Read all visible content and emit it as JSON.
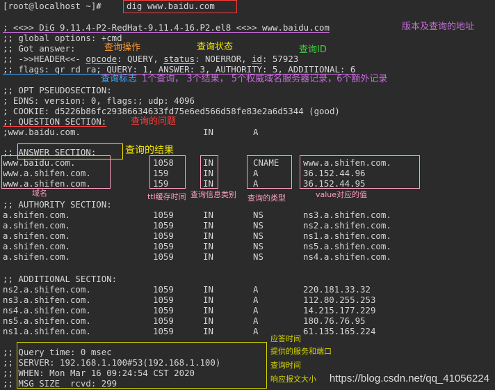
{
  "prompt": "[root@localhost ~]#",
  "command": "dig www.baidu.com",
  "header": {
    "banner": "; <<>> DiG 9.11.4-P2-RedHat-9.11.4-16.P2.el8 <<>> www.baidu.com",
    "global_options": ";; global options: +cmd",
    "got_answer": ";; Got answer:",
    "hdr_prefix": ";; ->>HEADER<<- ",
    "opcode": "opcode",
    "opcode_val": ": QUERY, ",
    "status": "status",
    "status_val": ": NOERROR, ",
    "id": "id",
    "id_val": ": 57923",
    "flags": ";; flags: qr rd ra;",
    "counts": " QUERY: 1, ANSWER: 3, AUTHORITY: 5, ADDITIONAL: 6"
  },
  "opt": {
    "title": ";; OPT PSEUDOSECTION:",
    "edns": "; EDNS: version: 0, flags:; udp: 4096",
    "cookie": "; COOKIE: d5226b86fc29386634633fd75e6ed566d58fe83e2a6d5344 (good)"
  },
  "question": {
    "title": ";; QUESTION SECTION:",
    "row": {
      "name": ";www.baidu.com.",
      "cls": "IN",
      "type": "A"
    }
  },
  "answer": {
    "title": ";; ANSWER SECTION:",
    "rows": [
      {
        "name": "www.baidu.com.",
        "ttl": "1058",
        "cls": "IN",
        "type": "CNAME",
        "value": "www.a.shifen.com."
      },
      {
        "name": "www.a.shifen.com.",
        "ttl": "159",
        "cls": "IN",
        "type": "A",
        "value": "36.152.44.96"
      },
      {
        "name": "www.a.shifen.com.",
        "ttl": "159",
        "cls": "IN",
        "type": "A",
        "value": "36.152.44.95"
      }
    ]
  },
  "authority": {
    "title": ";; AUTHORITY SECTION:",
    "rows": [
      {
        "name": "a.shifen.com.",
        "ttl": "1059",
        "cls": "IN",
        "type": "NS",
        "value": "ns3.a.shifen.com."
      },
      {
        "name": "a.shifen.com.",
        "ttl": "1059",
        "cls": "IN",
        "type": "NS",
        "value": "ns2.a.shifen.com."
      },
      {
        "name": "a.shifen.com.",
        "ttl": "1059",
        "cls": "IN",
        "type": "NS",
        "value": "ns1.a.shifen.com."
      },
      {
        "name": "a.shifen.com.",
        "ttl": "1059",
        "cls": "IN",
        "type": "NS",
        "value": "ns5.a.shifen.com."
      },
      {
        "name": "a.shifen.com.",
        "ttl": "1059",
        "cls": "IN",
        "type": "NS",
        "value": "ns4.a.shifen.com."
      }
    ]
  },
  "additional": {
    "title": ";; ADDITIONAL SECTION:",
    "rows": [
      {
        "name": "ns2.a.shifen.com.",
        "ttl": "1059",
        "cls": "IN",
        "type": "A",
        "value": "220.181.33.32"
      },
      {
        "name": "ns3.a.shifen.com.",
        "ttl": "1059",
        "cls": "IN",
        "type": "A",
        "value": "112.80.255.253"
      },
      {
        "name": "ns4.a.shifen.com.",
        "ttl": "1059",
        "cls": "IN",
        "type": "A",
        "value": "14.215.177.229"
      },
      {
        "name": "ns5.a.shifen.com.",
        "ttl": "1059",
        "cls": "IN",
        "type": "A",
        "value": "180.76.76.95"
      },
      {
        "name": "ns1.a.shifen.com.",
        "ttl": "1059",
        "cls": "IN",
        "type": "A",
        "value": "61.135.165.224"
      }
    ]
  },
  "footer": {
    "query_time": ";; Query time: 0 msec",
    "server": ";; SERVER: 192.168.1.100#53(192.168.1.100)",
    "when": ";; WHEN: Mon Mar 16 09:24:54 CST 2020",
    "msg_size": ";; MSG SIZE  rcvd: 299"
  },
  "annotations": {
    "version": "版本及查询的地址",
    "opcode": "查询操作",
    "status": "查询状态",
    "id": "查询ID",
    "flags": "查询标志",
    "counts": "1个查询， 3个结果，   5个权威域名服务器记录，6个额外记录",
    "question": "查询的问题",
    "answer": "查询的结果",
    "col_name": "域名",
    "col_ttl": "ttl缓存时间",
    "col_cls": "查询信息类别",
    "col_type": "查询的类型",
    "col_value": "value对应的值",
    "answer_time": "应答时间",
    "server": "提供的服务和端口",
    "query_when": "查询时间",
    "msg_size": "响应报文大小"
  },
  "watermark": "https://blog.csdn.net/qq_41056224",
  "colors": {
    "background": "#2b2b2b",
    "text": "#d6d6d6",
    "red": "#ff3c3c",
    "pink": "#ff9ec4",
    "orange": "#ff9a2e",
    "yellow": "#f2e600",
    "green": "#3fd03f",
    "blue": "#3da8ff",
    "purple": "#c86bdc",
    "olive": "#d4d400"
  }
}
